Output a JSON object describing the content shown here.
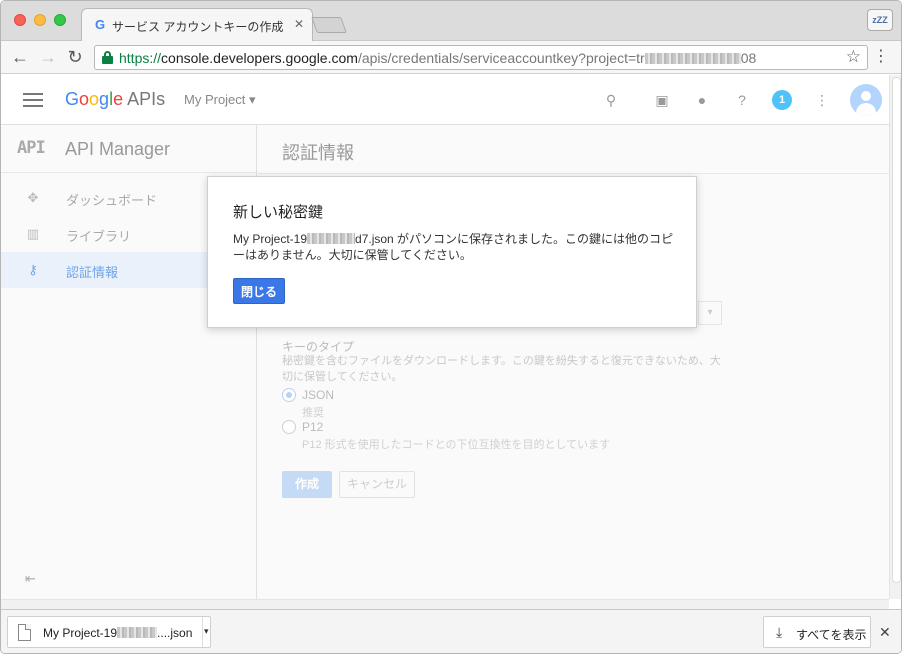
{
  "browser": {
    "tab_title": "サービス アカウントキーの作成",
    "tab_favicon": "G",
    "url_scheme": "https://",
    "url_host": "console.developers.google.com",
    "url_path": "/apis/credentials/serviceaccountkey?project=tr",
    "url_tail": "08",
    "sleep_label": "zZZ"
  },
  "appbar": {
    "logo_google": [
      "G",
      "o",
      "o",
      "g",
      "l",
      "e"
    ],
    "logo_suffix": " APIs",
    "project": "My Project",
    "notification_count": "1"
  },
  "sidebar": {
    "api_mark": "API",
    "title": "API Manager",
    "items": [
      {
        "label": "ダッシュボード",
        "icon": "dashboard-icon"
      },
      {
        "label": "ライブラリ",
        "icon": "library-icon"
      },
      {
        "label": "認証情報",
        "icon": "key-icon"
      }
    ]
  },
  "main": {
    "title": "認証情報",
    "key_type_label": "キーのタイプ",
    "key_type_desc": "秘密鍵を含むファイルをダウンロードします。この鍵を紛失すると復元できないため、大切に保管してください。",
    "options": [
      {
        "label": "JSON",
        "sub": "推奨",
        "checked": true
      },
      {
        "label": "P12",
        "sub": "P12 形式を使用したコードとの下位互換性を目的としています",
        "checked": false
      }
    ],
    "create_label": "作成",
    "cancel_label": "キャンセル"
  },
  "dialog": {
    "title": "新しい秘密鍵",
    "body_prefix": "My Project-19",
    "body_suffix": "d7.json がパソコンに保存されました。この鍵には他のコピーはありません。大切に保管してください。",
    "close_label": "閉じる"
  },
  "download_shelf": {
    "file_prefix": "My Project-19",
    "file_suffix": "....json",
    "show_all_label": "すべてを表示",
    "close_label": "✕"
  },
  "colors": {
    "primary": "#3b78e7",
    "secure": "#0b8043",
    "badge": "#4fc3f7"
  }
}
